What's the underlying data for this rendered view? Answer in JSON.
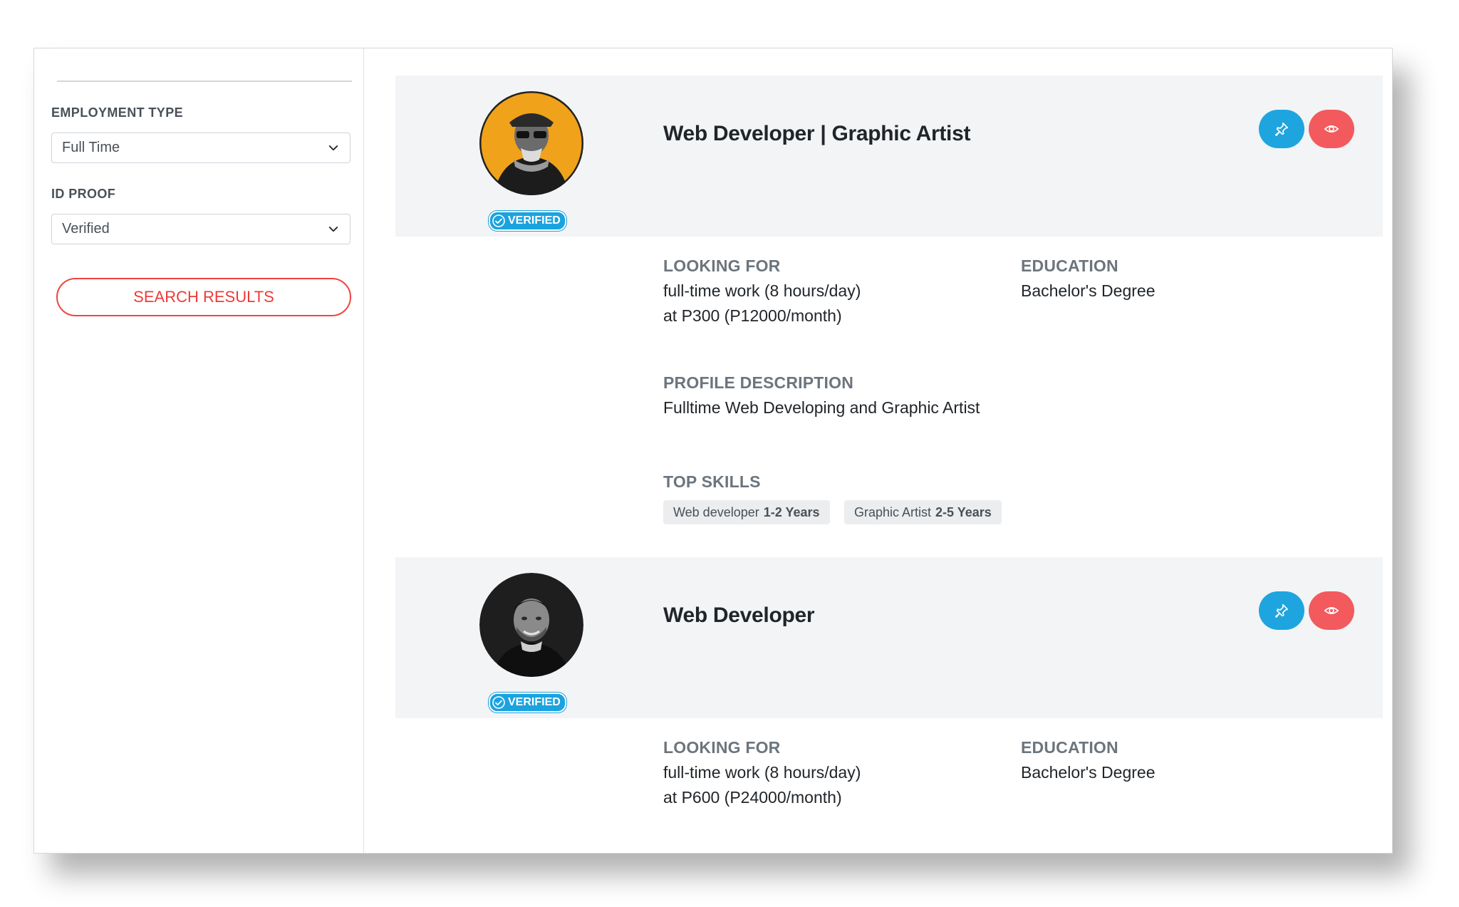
{
  "filters": {
    "employment_type": {
      "label": "EMPLOYMENT TYPE",
      "value": "Full Time"
    },
    "id_proof": {
      "label": "ID PROOF",
      "value": "Verified"
    },
    "search_button": "SEARCH RESULTS"
  },
  "results": [
    {
      "badge": "VERIFIED",
      "title": "Web Developer | Graphic Artist",
      "looking_for_label": "LOOKING FOR",
      "looking_for_line1": "full-time work (8 hours/day)",
      "looking_for_line2": "at P300 (P12000/month)",
      "education_label": "EDUCATION",
      "education": "Bachelor's Degree",
      "profile_label": "PROFILE DESCRIPTION",
      "profile": "Fulltime Web Developing and Graphic Artist",
      "skills_label": "TOP SKILLS",
      "skills": [
        {
          "name": "Web developer",
          "years": "1-2 Years"
        },
        {
          "name": "Graphic Artist",
          "years": "2-5 Years"
        }
      ]
    },
    {
      "badge": "VERIFIED",
      "title": "Web Developer",
      "looking_for_label": "LOOKING FOR",
      "looking_for_line1": "full-time work (8 hours/day)",
      "looking_for_line2": "at P600 (P24000/month)",
      "education_label": "EDUCATION",
      "education": "Bachelor's Degree"
    }
  ],
  "colors": {
    "pin": "#1ea5df",
    "view": "#f25a5d",
    "accent": "#ee3a36",
    "badge": "#1aa3df"
  },
  "icons": {
    "pin": "pin-icon",
    "view": "eye-icon",
    "dropdown": "chevron-down-icon",
    "badge": "check-circle-icon"
  }
}
